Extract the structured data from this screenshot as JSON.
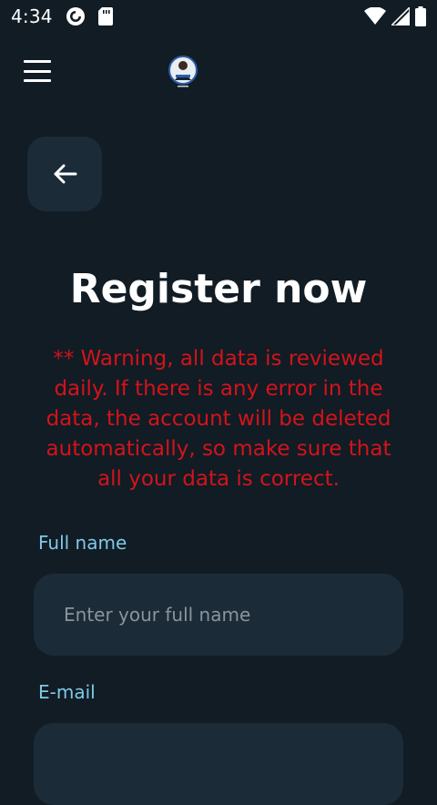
{
  "status_bar": {
    "time": "4:34",
    "icons": [
      "pocket-casts-icon",
      "sd-card-icon",
      "wifi-icon",
      "signal-icon",
      "battery-icon"
    ]
  },
  "app_bar": {
    "menu_icon": "hamburger-menu-icon",
    "logo_icon": "profile-logo"
  },
  "page": {
    "back_icon": "arrow-left-icon",
    "title": "Register now",
    "warning": "** Warning, all data is reviewed daily. If there is any error in the data, the account will be deleted automatically, so make sure that all your data is correct."
  },
  "form": {
    "full_name": {
      "label": "Full name",
      "placeholder": "Enter your full name",
      "value": ""
    },
    "email": {
      "label": "E-mail",
      "placeholder": "",
      "value": ""
    }
  },
  "colors": {
    "background": "#111c25",
    "surface": "#1c2b38",
    "label": "#7fc9e4",
    "warning": "#d4131a",
    "placeholder": "#8a949b"
  }
}
